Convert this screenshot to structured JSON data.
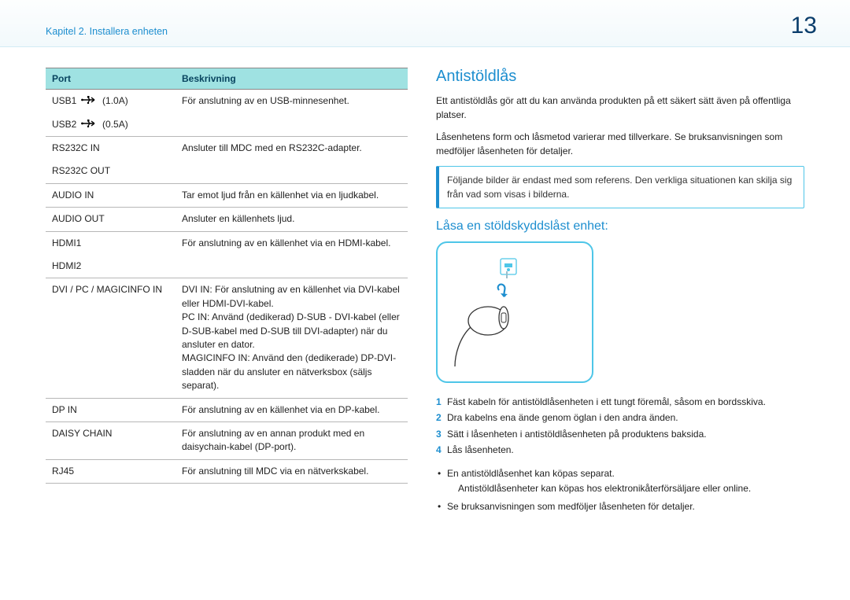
{
  "header": {
    "chapter_title": "Kapitel 2. Installera enheten",
    "page_number": "13"
  },
  "table": {
    "header_port": "Port",
    "header_desc": "Beskrivning",
    "rows": [
      {
        "port_prefix": "USB1",
        "port_suffix": "(1.0A)",
        "desc": "För anslutning av en USB-minnesenhet.",
        "icon": true,
        "border": false
      },
      {
        "port_prefix": "USB2",
        "port_suffix": "(0.5A)",
        "desc": "",
        "icon": true,
        "border": true
      },
      {
        "port": "RS232C IN",
        "desc": "Ansluter till MDC med en RS232C-adapter.",
        "border": false
      },
      {
        "port": "RS232C OUT",
        "desc": "",
        "border": true
      },
      {
        "port": "AUDIO IN",
        "desc": "Tar emot ljud från en källenhet via en ljudkabel.",
        "border": true
      },
      {
        "port": "AUDIO OUT",
        "desc": "Ansluter en källenhets ljud.",
        "border": true
      },
      {
        "port": "HDMI1",
        "desc": "För anslutning av en källenhet via en HDMI-kabel.",
        "border": false
      },
      {
        "port": "HDMI2",
        "desc": "",
        "border": true
      },
      {
        "port": "DVI / PC / MAGICINFO IN",
        "desc": "DVI IN: För anslutning av en källenhet via DVI-kabel eller HDMI-DVI-kabel.\nPC IN: Använd (dedikerad) D-SUB - DVI-kabel (eller D-SUB-kabel med D-SUB till DVI-adapter) när du ansluter en dator.\nMAGICINFO IN: Använd den (dedikerade) DP-DVI-sladden när du ansluter en nätverksbox (säljs separat).",
        "border": true
      },
      {
        "port": "DP IN",
        "desc": "För anslutning av en källenhet via en DP-kabel.",
        "border": true
      },
      {
        "port": "DAISY CHAIN",
        "desc": "För anslutning av en annan produkt med en daisychain-kabel (DP-port).",
        "border": true
      },
      {
        "port": "RJ45",
        "desc": "För anslutning till MDC via en nätverkskabel.",
        "border": true
      }
    ]
  },
  "right": {
    "title": "Antistöldlås",
    "intro1": "Ett antistöldlås gör att du kan använda produkten på ett säkert sätt även på offentliga platser.",
    "intro2": "Låsenhetens form och låsmetod varierar med tillverkare. Se bruksanvisningen som medföljer låsenheten för detaljer.",
    "note": "Följande bilder är endast med som referens. Den verkliga situationen kan skilja sig från vad som visas i bilderna.",
    "subtitle": "Låsa en stöldskyddslåst enhet:",
    "steps": [
      "Fäst kabeln för antistöldlåsenheten i ett tungt föremål, såsom en bordsskiva.",
      "Dra kabelns ena ände genom öglan i den andra änden.",
      "Sätt i låsenheten i antistöldlåsenheten på produktens baksida.",
      "Lås låsenheten."
    ],
    "bullet1a": "En antistöldlåsenhet kan köpas separat.",
    "bullet1b": "Antistöldlåsenheter kan köpas hos elektronikåterförsäljare eller online.",
    "bullet2": "Se bruksanvisningen som medföljer låsenheten för detaljer."
  }
}
